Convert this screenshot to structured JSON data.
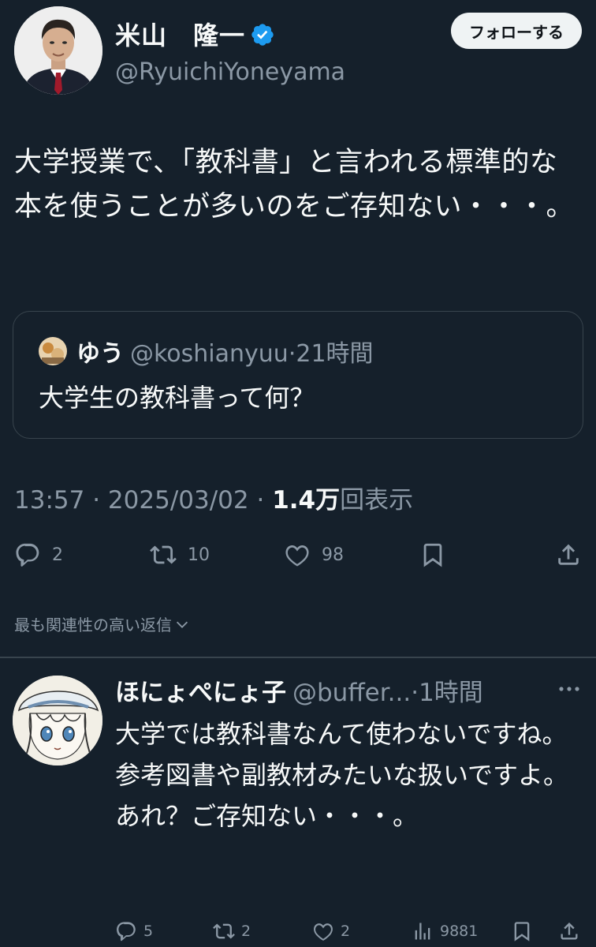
{
  "tweet": {
    "author_name": "米山　隆一",
    "author_handle": "@RyuichiYoneyama",
    "follow_label": "フォローする",
    "text": "大学授業で、「教科書」と言われる標準的な本を使うことが多いのをご存知ない・・・。",
    "quote": {
      "name": "ゆう",
      "handle": "@koshianyuu",
      "separator": "·",
      "time": "21時間",
      "text": "大学生の教科書って何？"
    },
    "time": "13:57",
    "separator": "·",
    "date": "2025/03/02",
    "views_count": "1.4万",
    "views_label": "回表示",
    "actions": {
      "reply_count": "2",
      "retweet_count": "10",
      "like_count": "98"
    }
  },
  "sort_label": "最も関連性の高い返信",
  "reply": {
    "author_name": "ほにょぺにょ子",
    "author_handle": "@buffer...",
    "separator": "·",
    "time": "1時間",
    "text_lines": [
      "大学では教科書なんて使わないですね。",
      "参考図書や副教材みたいな扱いですよ。",
      "あれ？ご存知ない・・・。"
    ],
    "actions": {
      "reply_count": "5",
      "retweet_count": "2",
      "like_count": "2",
      "views_count": "9881"
    }
  },
  "colors": {
    "background": "#15202b",
    "text_primary": "#f7f9f9",
    "text_secondary": "#8b98a5",
    "border": "#38444d",
    "verified_blue": "#1d9bf0"
  }
}
